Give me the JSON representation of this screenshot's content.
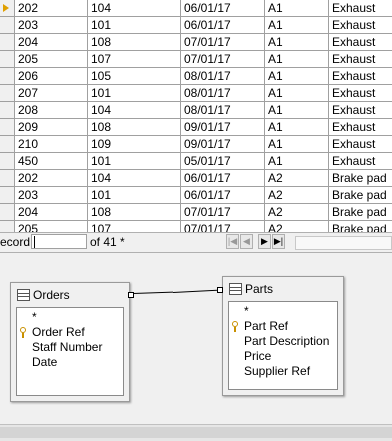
{
  "grid": {
    "rows": [
      {
        "c1": "202",
        "c2": "104",
        "c3": "06/01/17",
        "c4": "A1",
        "c5": "Exhaust",
        "current": true
      },
      {
        "c1": "203",
        "c2": "101",
        "c3": "06/01/17",
        "c4": "A1",
        "c5": "Exhaust"
      },
      {
        "c1": "204",
        "c2": "108",
        "c3": "07/01/17",
        "c4": "A1",
        "c5": "Exhaust"
      },
      {
        "c1": "205",
        "c2": "107",
        "c3": "07/01/17",
        "c4": "A1",
        "c5": "Exhaust"
      },
      {
        "c1": "206",
        "c2": "105",
        "c3": "08/01/17",
        "c4": "A1",
        "c5": "Exhaust"
      },
      {
        "c1": "207",
        "c2": "101",
        "c3": "08/01/17",
        "c4": "A1",
        "c5": "Exhaust"
      },
      {
        "c1": "208",
        "c2": "104",
        "c3": "08/01/17",
        "c4": "A1",
        "c5": "Exhaust"
      },
      {
        "c1": "209",
        "c2": "108",
        "c3": "09/01/17",
        "c4": "A1",
        "c5": "Exhaust"
      },
      {
        "c1": "210",
        "c2": "109",
        "c3": "09/01/17",
        "c4": "A1",
        "c5": "Exhaust"
      },
      {
        "c1": "450",
        "c2": "101",
        "c3": "05/01/17",
        "c4": "A1",
        "c5": "Exhaust"
      },
      {
        "c1": "202",
        "c2": "104",
        "c3": "06/01/17",
        "c4": "A2",
        "c5": "Brake pad"
      },
      {
        "c1": "203",
        "c2": "101",
        "c3": "06/01/17",
        "c4": "A2",
        "c5": "Brake pad"
      },
      {
        "c1": "204",
        "c2": "108",
        "c3": "07/01/17",
        "c4": "A2",
        "c5": "Brake pad"
      },
      {
        "c1": "205",
        "c2": "107",
        "c3": "07/01/17",
        "c4": "A2",
        "c5": "Brake pad"
      }
    ]
  },
  "navigator": {
    "record_label": "ecord",
    "record_value": "",
    "of_text": "of 41 *"
  },
  "orders_table": {
    "title": "Orders",
    "fields": [
      "*",
      "Order Ref",
      "Staff Number",
      "Date"
    ]
  },
  "parts_table": {
    "title": "Parts",
    "fields": [
      "*",
      "Part Ref",
      "Part Description",
      "Price",
      "Supplier Ref"
    ]
  },
  "colors": {
    "record_pointer": "#e0a000",
    "key_icon": "#c89000"
  }
}
